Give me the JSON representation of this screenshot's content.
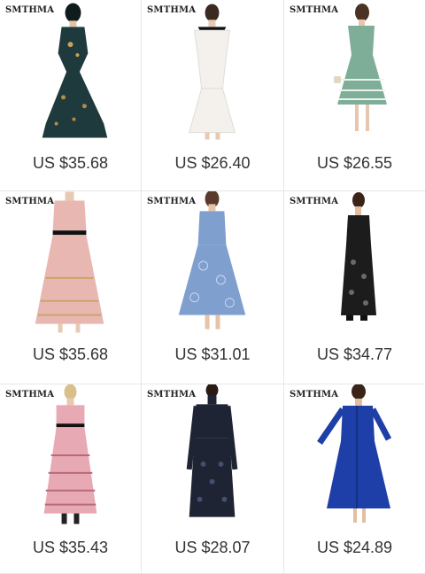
{
  "products": [
    {
      "brand": "SMTHMA",
      "price": "US $35.68",
      "dress": "dark-teal-floral-maxi-dress",
      "color": "#1f3a3c"
    },
    {
      "brand": "SMTHMA",
      "price": "US $26.40",
      "dress": "white-lace-off-shoulder-dress",
      "color": "#f4f1ec"
    },
    {
      "brand": "SMTHMA",
      "price": "US $26.55",
      "dress": "mint-green-lace-midi-dress",
      "color": "#7fae98"
    },
    {
      "brand": "SMTHMA",
      "price": "US $35.68",
      "dress": "pink-lace-collar-midi-dress",
      "color": "#e8b7b2"
    },
    {
      "brand": "SMTHMA",
      "price": "US $31.01",
      "dress": "blue-lace-strappy-midi-dress",
      "color": "#7f9fcf"
    },
    {
      "brand": "SMTHMA",
      "price": "US $34.77",
      "dress": "black-lace-slip-maxi-dress",
      "color": "#1c1c1c"
    },
    {
      "brand": "SMTHMA",
      "price": "US $35.43",
      "dress": "pink-crochet-maxi-dress",
      "color": "#e7a9b4"
    },
    {
      "brand": "SMTHMA",
      "price": "US $28.07",
      "dress": "navy-mesh-long-sleeve-dress",
      "color": "#1e2433"
    },
    {
      "brand": "SMTHMA",
      "price": "US $24.89",
      "dress": "royal-blue-shirt-dress",
      "color": "#1f3fa8"
    }
  ]
}
